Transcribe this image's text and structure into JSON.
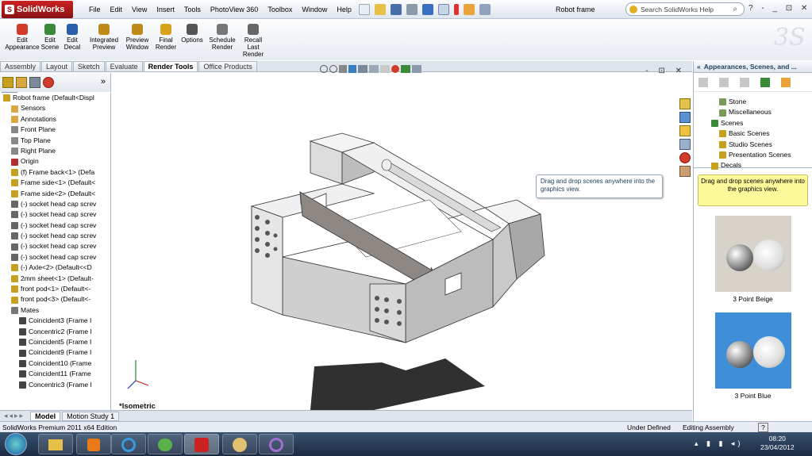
{
  "app": {
    "logo": "SolidWorks",
    "doc_title": "Robot frame"
  },
  "menu": [
    "File",
    "Edit",
    "View",
    "Insert",
    "Tools",
    "PhotoView 360",
    "Toolbox",
    "Window",
    "Help"
  ],
  "search_placeholder": "Search SolidWorks Help",
  "ribbon": [
    {
      "label": "Edit\nAppearance",
      "color": "#d23b2a"
    },
    {
      "label": "Edit\nScene",
      "color": "#3a8a3a"
    },
    {
      "label": "Edit\nDecal",
      "color": "#2b5da8"
    },
    {
      "label": "Integrated\nPreview",
      "color": "#c08a1a"
    },
    {
      "label": "Preview\nWindow",
      "color": "#c08a1a"
    },
    {
      "label": "Final\nRender",
      "color": "#d9a21b"
    },
    {
      "label": "Options",
      "color": "#555555"
    },
    {
      "label": "Schedule\nRender",
      "color": "#777777"
    },
    {
      "label": "Recall\nLast\nRender",
      "color": "#666666"
    }
  ],
  "tabs": [
    "Assembly",
    "Layout",
    "Sketch",
    "Evaluate",
    "Render Tools",
    "Office Products"
  ],
  "active_tab": "Render Tools",
  "tree": [
    {
      "label": "Robot frame  (Default<Displ",
      "color": "#c8a020"
    },
    {
      "label": "Sensors",
      "color": "#d8a840"
    },
    {
      "label": "Annotations",
      "color": "#d8a840"
    },
    {
      "label": "Front Plane",
      "color": "#888888"
    },
    {
      "label": "Top Plane",
      "color": "#888888"
    },
    {
      "label": "Right Plane",
      "color": "#888888"
    },
    {
      "label": "Origin",
      "color": "#b03030"
    },
    {
      "label": "(f) Frame back<1> (Defa",
      "color": "#c8a020"
    },
    {
      "label": "Frame side<1> (Default<",
      "color": "#c8a020"
    },
    {
      "label": "Frame side<2> (Default<",
      "color": "#c8a020"
    },
    {
      "label": "(-) socket head cap screv",
      "color": "#666666"
    },
    {
      "label": "(-) socket head cap screv",
      "color": "#666666"
    },
    {
      "label": "(-) socket head cap screv",
      "color": "#666666"
    },
    {
      "label": "(-) socket head cap screv",
      "color": "#666666"
    },
    {
      "label": "(-) socket head cap screv",
      "color": "#666666"
    },
    {
      "label": "(-) socket head cap screv",
      "color": "#666666"
    },
    {
      "label": "(-) Axle<2> (Default<<D",
      "color": "#c8a020"
    },
    {
      "label": "2mm sheet<1> (Default-",
      "color": "#c8a020"
    },
    {
      "label": "front pod<1> (Default<-",
      "color": "#c8a020"
    },
    {
      "label": "front pod<3> (Default<-",
      "color": "#c8a020"
    },
    {
      "label": "Mates",
      "color": "#777777"
    },
    {
      "label": "Coincident3 (Frame I",
      "color": "#444444"
    },
    {
      "label": "Concentric2 (Frame I",
      "color": "#444444"
    },
    {
      "label": "Coincident5 (Frame I",
      "color": "#444444"
    },
    {
      "label": "Coincident9 (Frame I",
      "color": "#444444"
    },
    {
      "label": "Coincident10 (Frame",
      "color": "#444444"
    },
    {
      "label": "Coincident11 (Frame",
      "color": "#444444"
    },
    {
      "label": "Concentric3 (Frame I",
      "color": "#444444"
    }
  ],
  "bottom_tabs": [
    "Model",
    "Motion Study 1"
  ],
  "view_label": "*Isometric",
  "tooltip": "Drag and drop scenes anywhere into the graphics view.",
  "right_panel": {
    "title": "Appearances, Scenes, and ...",
    "tree": [
      "Stone",
      "Miscellaneous",
      "Scenes",
      "Basic Scenes",
      "Studio Scenes",
      "Presentation Scenes",
      "Decals"
    ],
    "hint": "Drag and drop scenes anywhere into the graphics view.",
    "scenes": [
      {
        "label": "3 Point Beige",
        "bg": "#d8d3c8"
      },
      {
        "label": "3 Point Blue",
        "bg": "#3f8fd8"
      }
    ]
  },
  "status": {
    "left": "SolidWorks Premium 2011 x64 Edition",
    "state": "Under Defined",
    "mode": "Editing Assembly",
    "help": "?"
  },
  "clock": {
    "time": "08:20",
    "date": "23/04/2012"
  }
}
